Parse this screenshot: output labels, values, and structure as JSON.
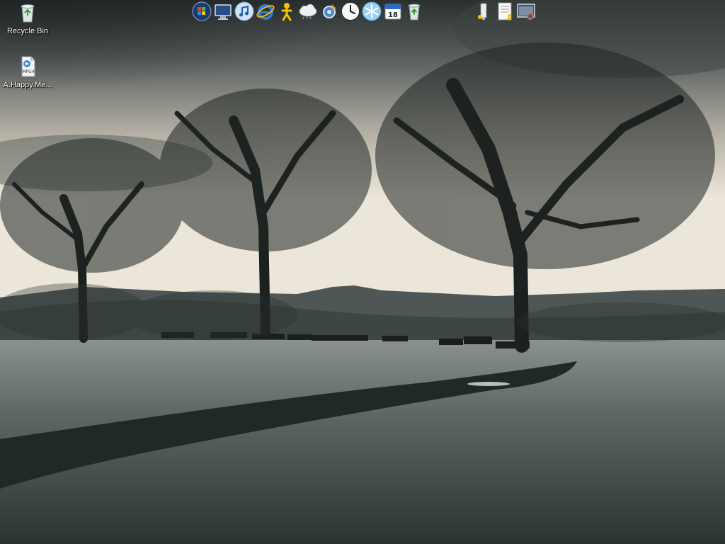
{
  "desktop": {
    "icons": [
      {
        "id": "recycle-bin",
        "label": "Recycle Bin",
        "icon": "recycle-bin-icon"
      },
      {
        "id": "mpg4-file",
        "label": "A.Happy.Me...",
        "icon": "mpg4-file-icon",
        "file_badge": "MPG4"
      }
    ]
  },
  "dock": {
    "left_items": [
      {
        "name": "windows-start-icon"
      },
      {
        "name": "my-computer-icon"
      },
      {
        "name": "itunes-icon"
      },
      {
        "name": "internet-explorer-icon"
      },
      {
        "name": "aim-icon"
      },
      {
        "name": "weather-icon"
      },
      {
        "name": "settings-icon"
      },
      {
        "name": "clock-icon"
      },
      {
        "name": "snowflake-icon"
      },
      {
        "name": "calendar-icon",
        "text": "18"
      },
      {
        "name": "recycle-bin-icon"
      }
    ],
    "right_items": [
      {
        "name": "usb-drive-icon"
      },
      {
        "name": "aim-notepad-icon"
      },
      {
        "name": "firefox-window-icon"
      }
    ]
  },
  "colors": {
    "icon_label": "#ffffff",
    "sky_light": "#e8e3d6",
    "grass": "#6c7470",
    "path": "#1a2422"
  }
}
